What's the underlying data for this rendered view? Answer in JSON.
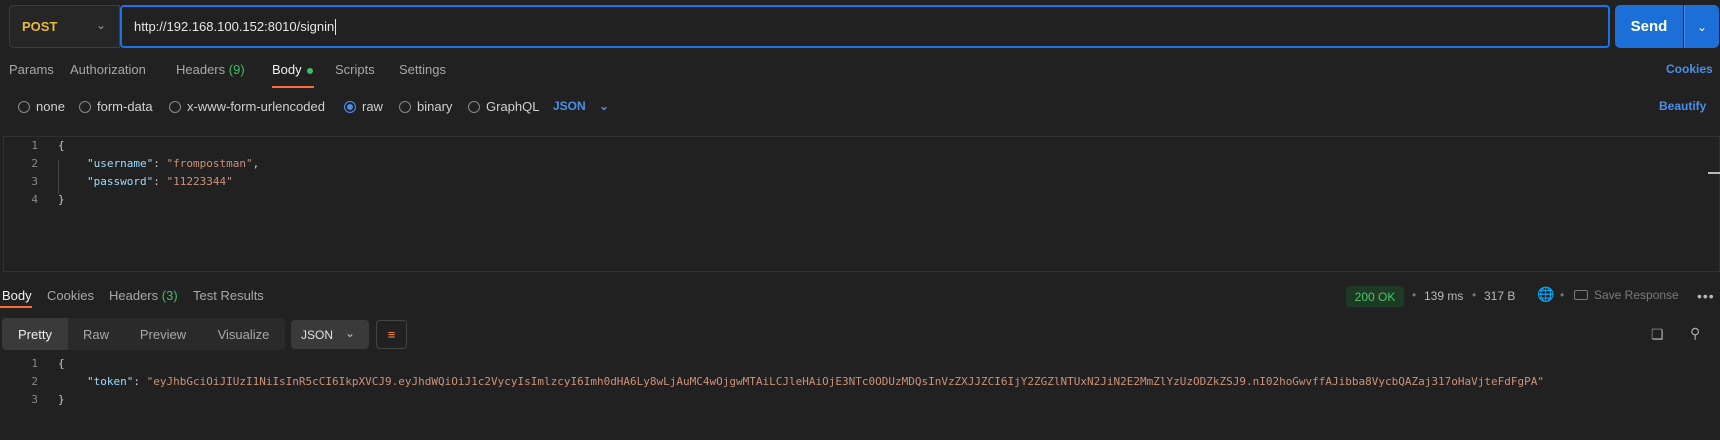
{
  "request": {
    "method": "POST",
    "url": "http://192.168.100.152:8010/signin",
    "send_label": "Send"
  },
  "request_tabs": {
    "params": "Params",
    "authorization": "Authorization",
    "headers": "Headers",
    "headers_count": "(9)",
    "body": "Body",
    "scripts": "Scripts",
    "settings": "Settings",
    "cookies": "Cookies"
  },
  "body_types": {
    "none": "none",
    "form_data": "form-data",
    "urlencoded": "x-www-form-urlencoded",
    "raw": "raw",
    "binary": "binary",
    "graphql": "GraphQL",
    "selected": "raw",
    "format": "JSON",
    "beautify": "Beautify"
  },
  "request_body": {
    "line_numbers": [
      "1",
      "2",
      "3",
      "4"
    ],
    "open_brace": "{",
    "close_brace": "}",
    "username_key": "\"username\"",
    "username_value": "\"frompostman\"",
    "password_key": "\"password\"",
    "password_value": "\"11223344\""
  },
  "response_tabs": {
    "body": "Body",
    "cookies": "Cookies",
    "headers": "Headers",
    "headers_count": "(3)",
    "test_results": "Test Results"
  },
  "response_meta": {
    "status": "200 OK",
    "time": "139 ms",
    "size": "317 B",
    "save_response": "Save Response"
  },
  "response_view": {
    "pretty": "Pretty",
    "raw": "Raw",
    "preview": "Preview",
    "visualize": "Visualize",
    "format": "JSON"
  },
  "response_body": {
    "line_numbers": [
      "1",
      "2",
      "3"
    ],
    "open_brace": "{",
    "close_brace": "}",
    "token_key": "\"token\"",
    "token_value": "\"eyJhbGciOiJIUzI1NiIsInR5cCI6IkpXVCJ9.eyJhdWQiOiJ1c2VycyIsImlzcyI6Imh0dHA6Ly8wLjAuMC4wOjgwMTAiLCJleHAiOjE3NTc0ODUzMDQsInVzZXJJZCI6IjY2ZGZlNTUxN2JiN2E2MmZlYzUzODZkZSJ9.nI02hoGwvffAJibba8VycbQAZaj317oHaVjteFdFgPA\""
  },
  "colors": {
    "accent": "#1d6fd8",
    "tab_indicator": "#ff6c37",
    "method": "#e8b93c",
    "status_ok": "#49c56a",
    "json_key": "#9cdcfe",
    "json_string": "#ce9178"
  }
}
